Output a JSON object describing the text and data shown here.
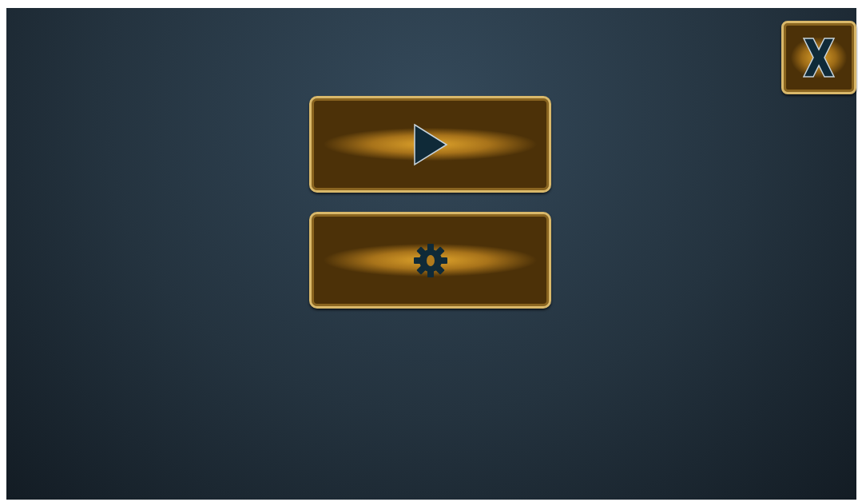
{
  "close_button": {
    "kind": "close"
  },
  "menu_buttons": [
    {
      "kind": "play"
    },
    {
      "kind": "settings"
    }
  ]
}
